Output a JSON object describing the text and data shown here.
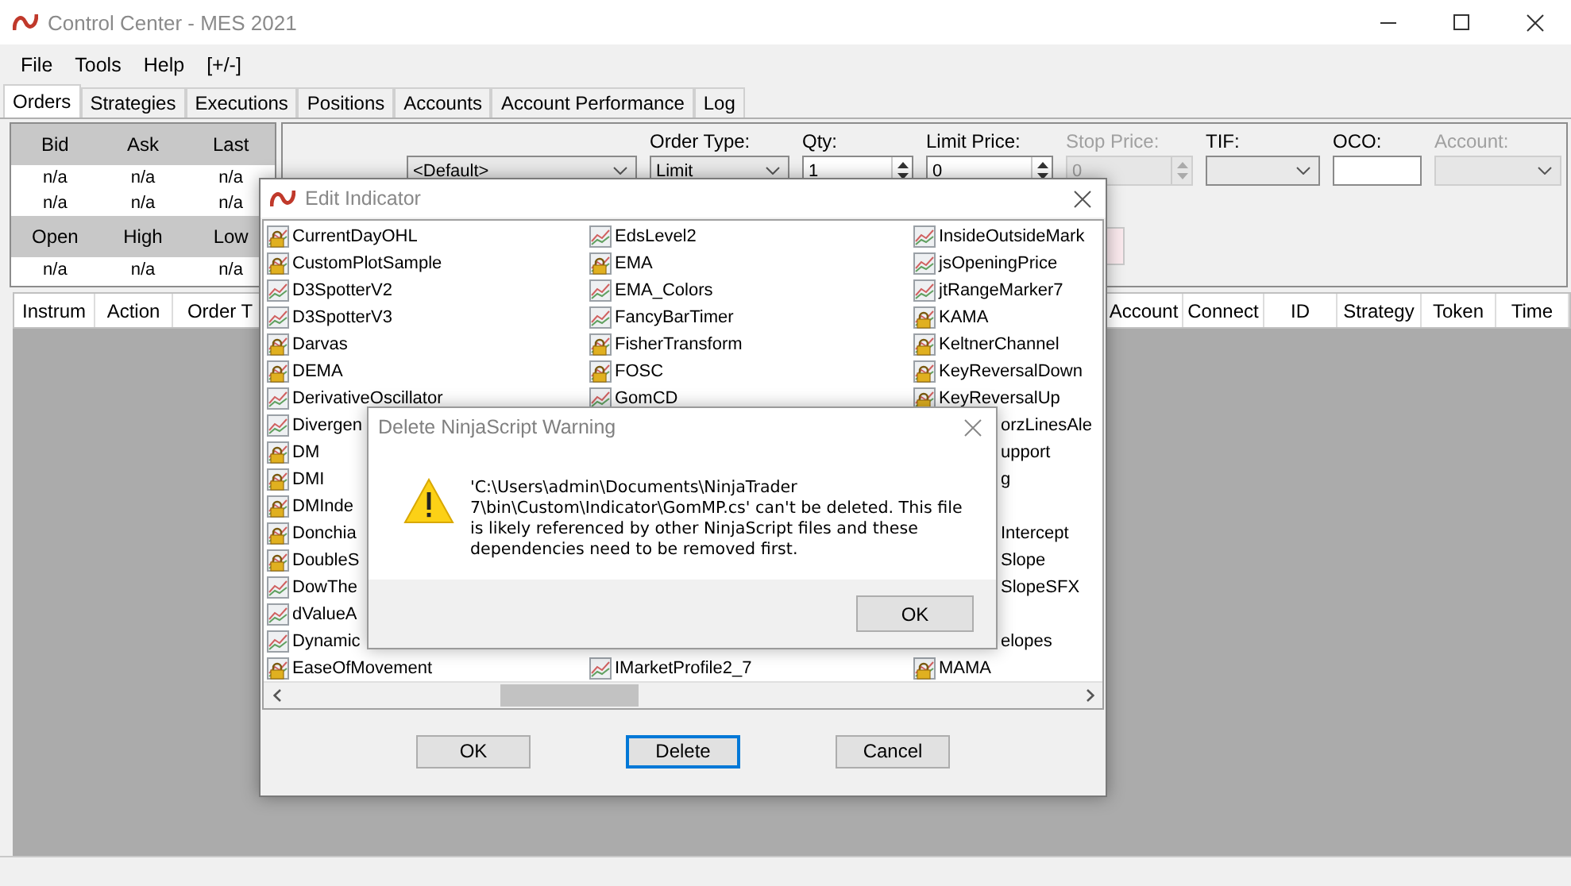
{
  "window": {
    "title": "Control Center - MES 2021"
  },
  "menu": [
    "File",
    "Tools",
    "Help",
    "[+/-]"
  ],
  "tabs": [
    {
      "label": "Orders",
      "selected": true
    },
    {
      "label": "Strategies",
      "selected": false
    },
    {
      "label": "Executions",
      "selected": false
    },
    {
      "label": "Positions",
      "selected": false
    },
    {
      "label": "Accounts",
      "selected": false
    },
    {
      "label": "Account Performance",
      "selected": false
    },
    {
      "label": "Log",
      "selected": false
    }
  ],
  "quote": {
    "sections": [
      {
        "headers": [
          "Bid",
          "Ask",
          "Last"
        ],
        "rows": [
          [
            "n/a",
            "n/a",
            "n/a"
          ],
          [
            "n/a",
            "n/a",
            "n/a"
          ]
        ]
      },
      {
        "headers": [
          "Open",
          "High",
          "Low"
        ],
        "rows": [
          [
            "n/a",
            "n/a",
            "n/a"
          ]
        ]
      }
    ]
  },
  "order_entry": {
    "fields": [
      {
        "kind": "dropdown",
        "value": "<Default>",
        "disabled": false
      },
      {
        "label": "Order Type:",
        "kind": "dropdown",
        "value": "Limit",
        "disabled": false
      },
      {
        "label": "Qty:",
        "kind": "spinner",
        "value": "1",
        "disabled": false
      },
      {
        "label": "Limit Price:",
        "kind": "spinner",
        "value": "0",
        "disabled": false
      },
      {
        "label": "Stop Price:",
        "kind": "spinner",
        "value": "0",
        "disabled": true
      },
      {
        "label": "TIF:",
        "kind": "dropdown",
        "disabled": false
      },
      {
        "label": "OCO:",
        "kind": "text",
        "disabled": false
      },
      {
        "label": "Account:",
        "kind": "dropdown",
        "disabled": true
      }
    ]
  },
  "orders_grid": {
    "columns_left": [
      "Instrum",
      "Action",
      "Order T"
    ],
    "columns_right": [
      "Account",
      "Connect",
      "ID",
      "Strategy",
      "Token",
      "Time"
    ]
  },
  "edit_indicator": {
    "title": "Edit Indicator",
    "columns": [
      [
        {
          "name": "CurrentDayOHL",
          "kind": "locked"
        },
        {
          "name": "CustomPlotSample",
          "kind": "locked"
        },
        {
          "name": "D3SpotterV2",
          "kind": "plain"
        },
        {
          "name": "D3SpotterV3",
          "kind": "plain"
        },
        {
          "name": "Darvas",
          "kind": "locked"
        },
        {
          "name": "DEMA",
          "kind": "locked"
        },
        {
          "name": "DerivativeOscillator",
          "kind": "plain"
        },
        {
          "name": "Divergen",
          "kind": "plain"
        },
        {
          "name": "DM",
          "kind": "locked"
        },
        {
          "name": "DMI",
          "kind": "locked"
        },
        {
          "name": "DMInde",
          "kind": "locked"
        },
        {
          "name": "Donchia",
          "kind": "locked"
        },
        {
          "name": "DoubleS",
          "kind": "locked"
        },
        {
          "name": "DowThe",
          "kind": "plain"
        },
        {
          "name": "dValueA",
          "kind": "plain"
        },
        {
          "name": "Dynamic",
          "kind": "plain"
        },
        {
          "name": "EaseOfMovement",
          "kind": "locked"
        }
      ],
      [
        {
          "name": "EdsLevel2",
          "kind": "plain"
        },
        {
          "name": "EMA",
          "kind": "locked"
        },
        {
          "name": "EMA_Colors",
          "kind": "plain"
        },
        {
          "name": "FancyBarTimer",
          "kind": "plain"
        },
        {
          "name": "FisherTransform",
          "kind": "locked"
        },
        {
          "name": "FOSC",
          "kind": "locked"
        },
        {
          "name": "GomCD",
          "kind": "plain"
        },
        {
          "kind": "covered"
        },
        {
          "kind": "covered"
        },
        {
          "kind": "covered"
        },
        {
          "kind": "covered"
        },
        {
          "kind": "covered"
        },
        {
          "kind": "covered"
        },
        {
          "kind": "covered"
        },
        {
          "kind": "covered"
        },
        {
          "kind": "covered"
        },
        {
          "name": "IMarketProfile2_7",
          "kind": "plain"
        }
      ],
      [
        {
          "name": "InsideOutsideMark",
          "kind": "plain"
        },
        {
          "name": "jsOpeningPrice",
          "kind": "plain"
        },
        {
          "name": "jtRangeMarker7",
          "kind": "plain"
        },
        {
          "name": "KAMA",
          "kind": "locked"
        },
        {
          "name": "KeltnerChannel",
          "kind": "locked"
        },
        {
          "name": "KeyReversalDown",
          "kind": "locked"
        },
        {
          "name": "KeyReversalUp",
          "kind": "locked"
        },
        {
          "name": "orzLinesAle",
          "kind": "clipped"
        },
        {
          "name": "upport",
          "kind": "clipped"
        },
        {
          "name": "g",
          "kind": "clipped"
        },
        {
          "kind": "covered"
        },
        {
          "name": "Intercept",
          "kind": "clipped"
        },
        {
          "name": "Slope",
          "kind": "clipped"
        },
        {
          "name": "SlopeSFX",
          "kind": "clipped"
        },
        {
          "kind": "covered"
        },
        {
          "name": "elopes",
          "kind": "clipped"
        },
        {
          "name": "MAMA",
          "kind": "locked"
        }
      ]
    ],
    "buttons": [
      {
        "label": "OK",
        "focused": false
      },
      {
        "label": "Delete",
        "focused": true
      },
      {
        "label": "Cancel",
        "focused": false
      }
    ]
  },
  "warning": {
    "title": "Delete NinjaScript Warning",
    "message": "'C:\\Users\\admin\\Documents\\NinjaTrader 7\\bin\\Custom\\Indicator\\GomMP.cs' can't be deleted. This file is likely referenced by other NinjaScript files and these dependencies need to be removed first.",
    "button": "OK"
  }
}
